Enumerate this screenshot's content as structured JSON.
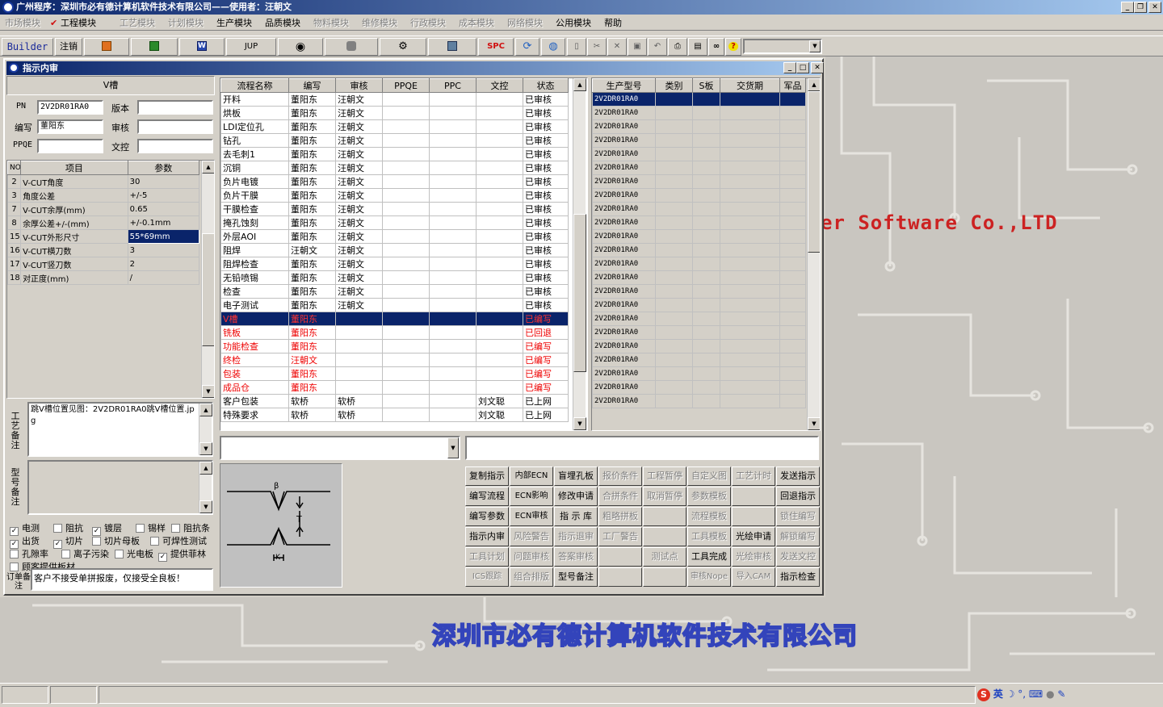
{
  "window": {
    "title": "广州程序：深圳市必有德计算机软件技术有限公司——使用者：汪朝文"
  },
  "menu": [
    {
      "label": "市场模块",
      "enabled": false
    },
    {
      "label": "工程模块",
      "enabled": true,
      "checked": true
    },
    {
      "label": "工艺模块",
      "enabled": false
    },
    {
      "label": "计划模块",
      "enabled": false
    },
    {
      "label": "生产模块",
      "enabled": true
    },
    {
      "label": "品质模块",
      "enabled": true
    },
    {
      "label": "物料模块",
      "enabled": false
    },
    {
      "label": "维修模块",
      "enabled": false
    },
    {
      "label": "行政模块",
      "enabled": false
    },
    {
      "label": "成本模块",
      "enabled": false
    },
    {
      "label": "网络模块",
      "enabled": false
    },
    {
      "label": "公用模块",
      "enabled": true
    },
    {
      "label": "帮助",
      "enabled": true
    }
  ],
  "toolbar": {
    "builder": "Builder",
    "logout": "注销",
    "jup": "JUP",
    "spc": "SPC"
  },
  "mdi": {
    "title": "指示内审"
  },
  "left": {
    "section_title": "V槽",
    "pn_label": "PN",
    "pn_value": "2V2DR01RA0",
    "version_label": "版本",
    "version_value": "",
    "editor_label": "编写",
    "editor_value": "董阳东",
    "reviewer_label": "审核",
    "reviewer_value": "",
    "ppqe_label": "PPQE",
    "ppqe_value": "",
    "doc_label": "文控",
    "doc_value": "",
    "param_headers": [
      "NO",
      "项目",
      "参数"
    ],
    "params": [
      [
        "2",
        "V-CUT角度",
        "30"
      ],
      [
        "3",
        "角度公差",
        "+/-5"
      ],
      [
        "7",
        "V-CUT余厚(mm)",
        "0.65"
      ],
      [
        "8",
        "余厚公差+/-(mm)",
        "+/-0.1mm"
      ],
      [
        "15",
        "V-CUT外形尺寸",
        "55*69mm"
      ],
      [
        "16",
        "V-CUT横刀数",
        "3"
      ],
      [
        "17",
        "V-CUT竖刀数",
        "2"
      ],
      [
        "18",
        "对正度(mm)",
        "/"
      ]
    ],
    "process_note_label": "工艺备注",
    "process_note": "跳V槽位置见图：2V2DR01RA0跳V槽位置.jpg",
    "model_note_label": "型号备注",
    "model_note": "",
    "checkboxes": [
      {
        "label": "电测",
        "checked": true
      },
      {
        "label": "阻抗",
        "checked": false
      },
      {
        "label": "镀层",
        "checked": true
      },
      {
        "label": "锡样",
        "checked": false
      },
      {
        "label": "阻抗条",
        "checked": false
      },
      {
        "label": "出货",
        "checked": true
      },
      {
        "label": "切片",
        "checked": true
      },
      {
        "label": "切片母板",
        "checked": false
      },
      {
        "label": "可焊性测试",
        "checked": false
      },
      {
        "label": "孔隙率",
        "checked": false
      },
      {
        "label": "离子污染",
        "checked": false
      },
      {
        "label": "光电板",
        "checked": false
      },
      {
        "label": "提供菲林",
        "checked": true
      },
      {
        "label": "顾客提供板材",
        "checked": false
      }
    ],
    "order_note_label": "订单备注",
    "order_note": "客户不接受单拼报废，仅接受全良板！"
  },
  "process": {
    "headers": [
      "流程名称",
      "编写",
      "审核",
      "PPQE",
      "PPC",
      "文控",
      "状态"
    ],
    "rows": [
      [
        "开料",
        "董阳东",
        "汪朝文",
        "",
        "",
        "",
        "已审核"
      ],
      [
        "烘板",
        "董阳东",
        "汪朝文",
        "",
        "",
        "",
        "已审核"
      ],
      [
        "LDI定位孔",
        "董阳东",
        "汪朝文",
        "",
        "",
        "",
        "已审核"
      ],
      [
        "钻孔",
        "董阳东",
        "汪朝文",
        "",
        "",
        "",
        "已审核"
      ],
      [
        "去毛刺1",
        "董阳东",
        "汪朝文",
        "",
        "",
        "",
        "已审核"
      ],
      [
        "沉铜",
        "董阳东",
        "汪朝文",
        "",
        "",
        "",
        "已审核"
      ],
      [
        "负片电镀",
        "董阳东",
        "汪朝文",
        "",
        "",
        "",
        "已审核"
      ],
      [
        "负片干膜",
        "董阳东",
        "汪朝文",
        "",
        "",
        "",
        "已审核"
      ],
      [
        "干膜检查",
        "董阳东",
        "汪朝文",
        "",
        "",
        "",
        "已审核"
      ],
      [
        "掩孔蚀刻",
        "董阳东",
        "汪朝文",
        "",
        "",
        "",
        "已审核"
      ],
      [
        "外层AOI",
        "董阳东",
        "汪朝文",
        "",
        "",
        "",
        "已审核"
      ],
      [
        "阻焊",
        "汪朝文",
        "汪朝文",
        "",
        "",
        "",
        "已审核"
      ],
      [
        "阻焊检查",
        "董阳东",
        "汪朝文",
        "",
        "",
        "",
        "已审核"
      ],
      [
        "无铅喷锡",
        "董阳东",
        "汪朝文",
        "",
        "",
        "",
        "已审核"
      ],
      [
        "检查",
        "董阳东",
        "汪朝文",
        "",
        "",
        "",
        "已审核"
      ],
      [
        "电子测试",
        "董阳东",
        "汪朝文",
        "",
        "",
        "",
        "已审核"
      ],
      [
        "V槽",
        "董阳东",
        "",
        "",
        "",
        "",
        "已编写"
      ],
      [
        "铣板",
        "董阳东",
        "",
        "",
        "",
        "",
        "已回退"
      ],
      [
        "功能检查",
        "董阳东",
        "",
        "",
        "",
        "",
        "已编写"
      ],
      [
        "终检",
        "汪朝文",
        "",
        "",
        "",
        "",
        "已编写"
      ],
      [
        "包装",
        "董阳东",
        "",
        "",
        "",
        "",
        "已编写"
      ],
      [
        "成品仓",
        "董阳东",
        "",
        "",
        "",
        "",
        "已编写"
      ],
      [
        "客户包装",
        "软桥",
        "软桥",
        "",
        "",
        "刘文聪",
        "已上网"
      ],
      [
        "特殊要求",
        "软桥",
        "软桥",
        "",
        "",
        "刘文聪",
        "已上网"
      ]
    ],
    "selected_row": 16,
    "red_rows": [
      17,
      18,
      19,
      20,
      21
    ]
  },
  "models": {
    "headers": [
      "生产型号",
      "类别",
      "S板",
      "交货期",
      "军品"
    ],
    "rows": [
      "2V2DR01RA0",
      "2V2DR01RA0",
      "2V2DR01RA0",
      "2V2DR01RA0",
      "2V2DR01RA0",
      "2V2DR01RA0",
      "2V2DR01RA0",
      "2V2DR01RA0",
      "2V2DR01RA0",
      "2V2DR01RA0",
      "2V2DR01RA0",
      "2V2DR01RA0",
      "2V2DR01RA0",
      "2V2DR01RA0",
      "2V2DR01RA0",
      "2V2DR01RA0",
      "2V2DR01RA0",
      "2V2DR01RA0",
      "2V2DR01RA0",
      "2V2DR01RA0",
      "2V2DR01RA0",
      "2V2DR01RA0",
      "2V2DR01RA0"
    ]
  },
  "diagram": {
    "angle_label": "β",
    "thickness_label": "T",
    "residual_label": "K"
  },
  "actions": [
    [
      {
        "label": "复制指示",
        "enabled": true
      },
      {
        "label": "内部ECN",
        "enabled": true
      },
      {
        "label": "盲埋孔板",
        "enabled": true
      },
      {
        "label": "报价条件",
        "enabled": false
      },
      {
        "label": "工程暂停",
        "enabled": false
      },
      {
        "label": "自定义图",
        "enabled": false
      },
      {
        "label": "工艺计时",
        "enabled": false
      },
      {
        "label": "发送指示",
        "enabled": true
      }
    ],
    [
      {
        "label": "编写流程",
        "enabled": true
      },
      {
        "label": "ECN影响",
        "enabled": true
      },
      {
        "label": "修改申请",
        "enabled": true
      },
      {
        "label": "合拼条件",
        "enabled": false
      },
      {
        "label": "取消暂停",
        "enabled": false
      },
      {
        "label": "参数模板",
        "enabled": false
      },
      {
        "label": "",
        "enabled": false
      },
      {
        "label": "回退指示",
        "enabled": true
      }
    ],
    [
      {
        "label": "编写参数",
        "enabled": true
      },
      {
        "label": "ECN审核",
        "enabled": true
      },
      {
        "label": "指 示 库",
        "enabled": true
      },
      {
        "label": "粗略拼板",
        "enabled": false
      },
      {
        "label": "",
        "enabled": false
      },
      {
        "label": "流程模板",
        "enabled": false
      },
      {
        "label": "",
        "enabled": false
      },
      {
        "label": "锁住编写",
        "enabled": false
      }
    ],
    [
      {
        "label": "指示内审",
        "enabled": true
      },
      {
        "label": "风险警告",
        "enabled": false
      },
      {
        "label": "指示退审",
        "enabled": false
      },
      {
        "label": "工厂警告",
        "enabled": false
      },
      {
        "label": "",
        "enabled": false
      },
      {
        "label": "工具模板",
        "enabled": false
      },
      {
        "label": "光绘申请",
        "enabled": true
      },
      {
        "label": "解锁编写",
        "enabled": false
      }
    ],
    [
      {
        "label": "工具计划",
        "enabled": false
      },
      {
        "label": "问题审核",
        "enabled": false
      },
      {
        "label": "答案审核",
        "enabled": false
      },
      {
        "label": "",
        "enabled": false
      },
      {
        "label": "测试点",
        "enabled": false
      },
      {
        "label": "工具完成",
        "enabled": true
      },
      {
        "label": "光绘审核",
        "enabled": false
      },
      {
        "label": "发送文控",
        "enabled": false
      }
    ],
    [
      {
        "label": "ICS跟踪",
        "enabled": false
      },
      {
        "label": "组合排版",
        "enabled": false
      },
      {
        "label": "型号备注",
        "enabled": true
      },
      {
        "label": "",
        "enabled": false
      },
      {
        "label": "",
        "enabled": false
      },
      {
        "label": "审核Nope",
        "enabled": false
      },
      {
        "label": "导入CAM",
        "enabled": false
      },
      {
        "label": "指示检查",
        "enabled": true
      }
    ]
  ],
  "background": {
    "watermark": "er Software Co.,LTD",
    "company": "深圳市必有德计算机软件技术有限公司"
  },
  "ime": {
    "lang": "英"
  }
}
